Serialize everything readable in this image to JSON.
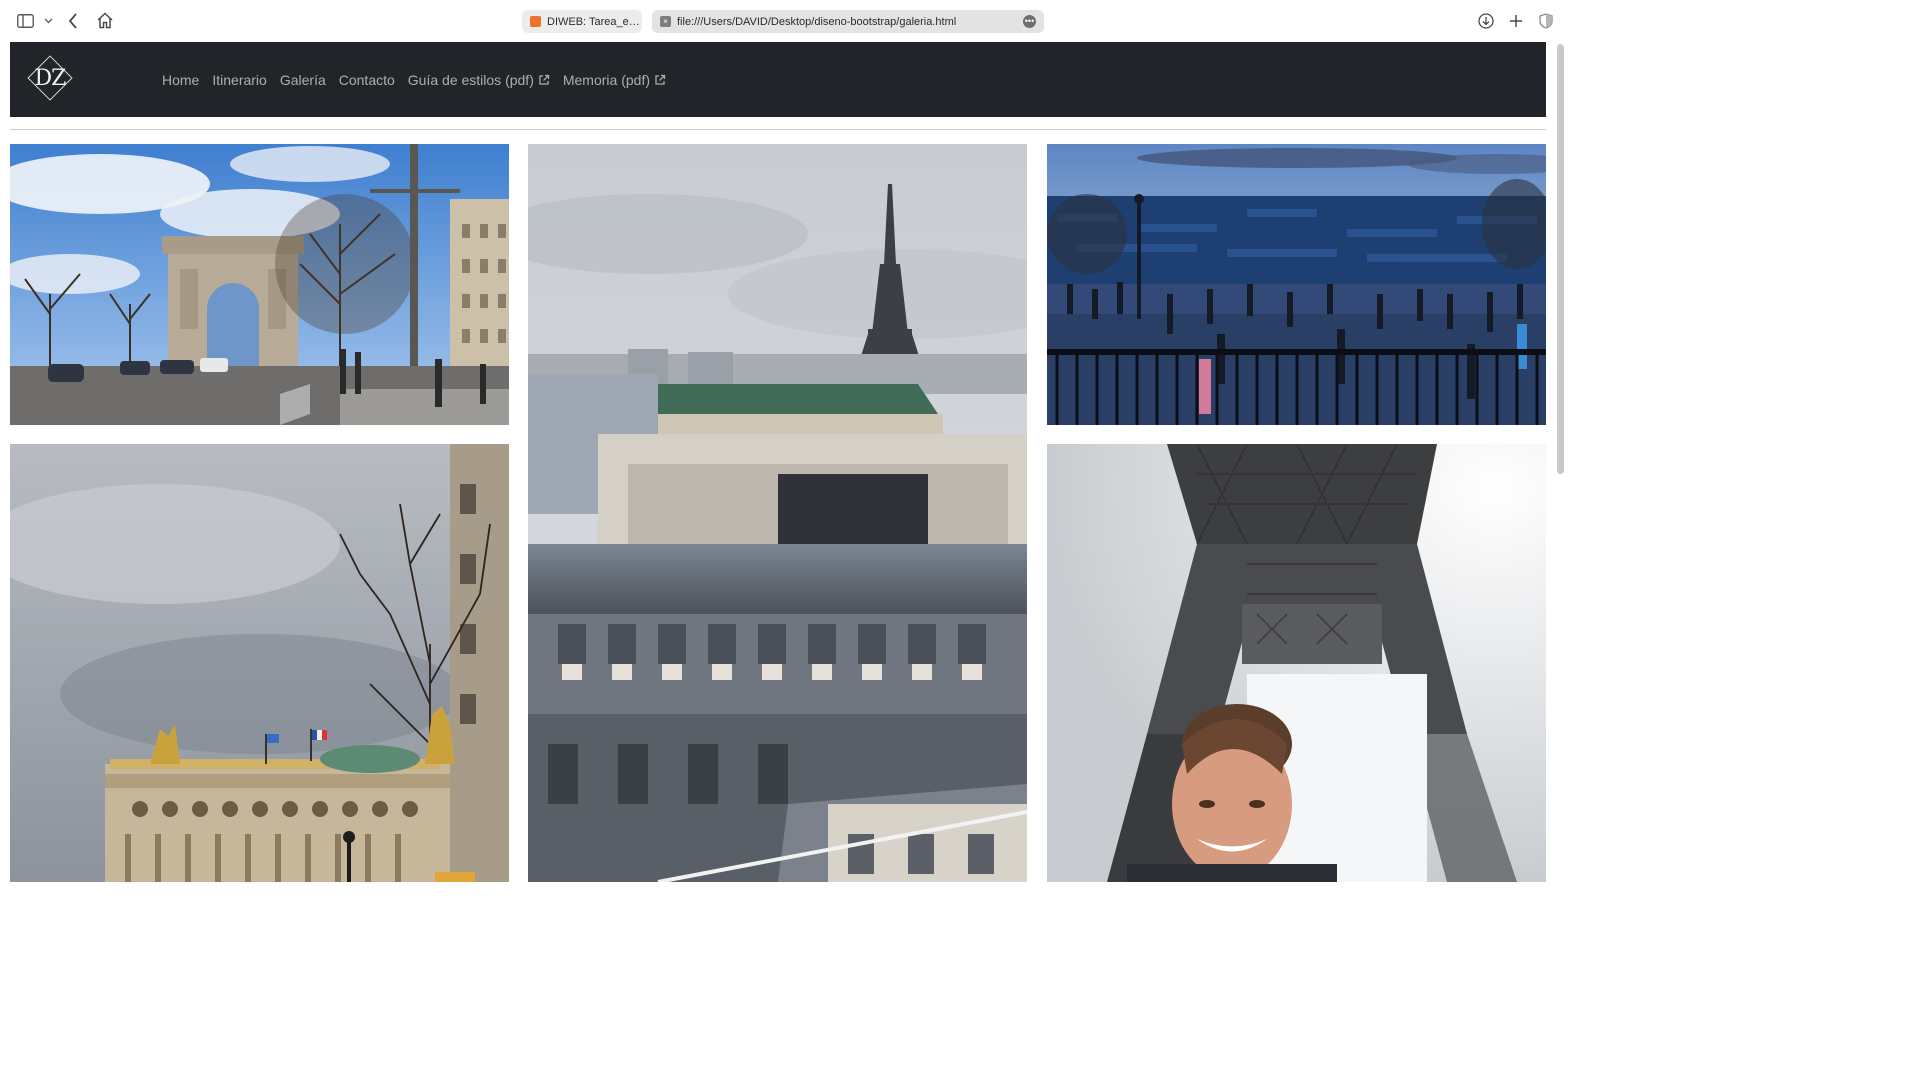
{
  "browser": {
    "tabs": [
      {
        "title": "DIWEB: Tarea_eje...",
        "active": false
      },
      {
        "title": "file:///Users/DAVID/Desktop/diseno-bootstrap/galeria.html",
        "active": true
      }
    ],
    "icons": {
      "sidebar": "sidebar-icon",
      "back": "chevron-left-icon",
      "home": "home-icon",
      "download": "download-icon",
      "new_tab": "plus-icon",
      "privacy": "shield-icon"
    }
  },
  "navbar": {
    "brand": "DZ",
    "links": [
      {
        "label": "Home",
        "external": false
      },
      {
        "label": "Itinerario",
        "external": false
      },
      {
        "label": "Galería",
        "external": false
      },
      {
        "label": "Contacto",
        "external": false
      },
      {
        "label": "Guía de estilos (pdf)",
        "external": true
      },
      {
        "label": "Memoria (pdf)",
        "external": true
      }
    ]
  },
  "gallery": {
    "photos": [
      {
        "subject": "arc-de-triomphe"
      },
      {
        "subject": "eiffel-tower-rooftops"
      },
      {
        "subject": "montmartre-view"
      },
      {
        "subject": "palais-garnier"
      },
      {
        "subject": "eiffel-tower-selfie"
      }
    ]
  },
  "colors": {
    "navbar_bg": "#212529",
    "nav_link": "rgba(255,255,255,0.62)",
    "page_bg": "#ffffff"
  }
}
